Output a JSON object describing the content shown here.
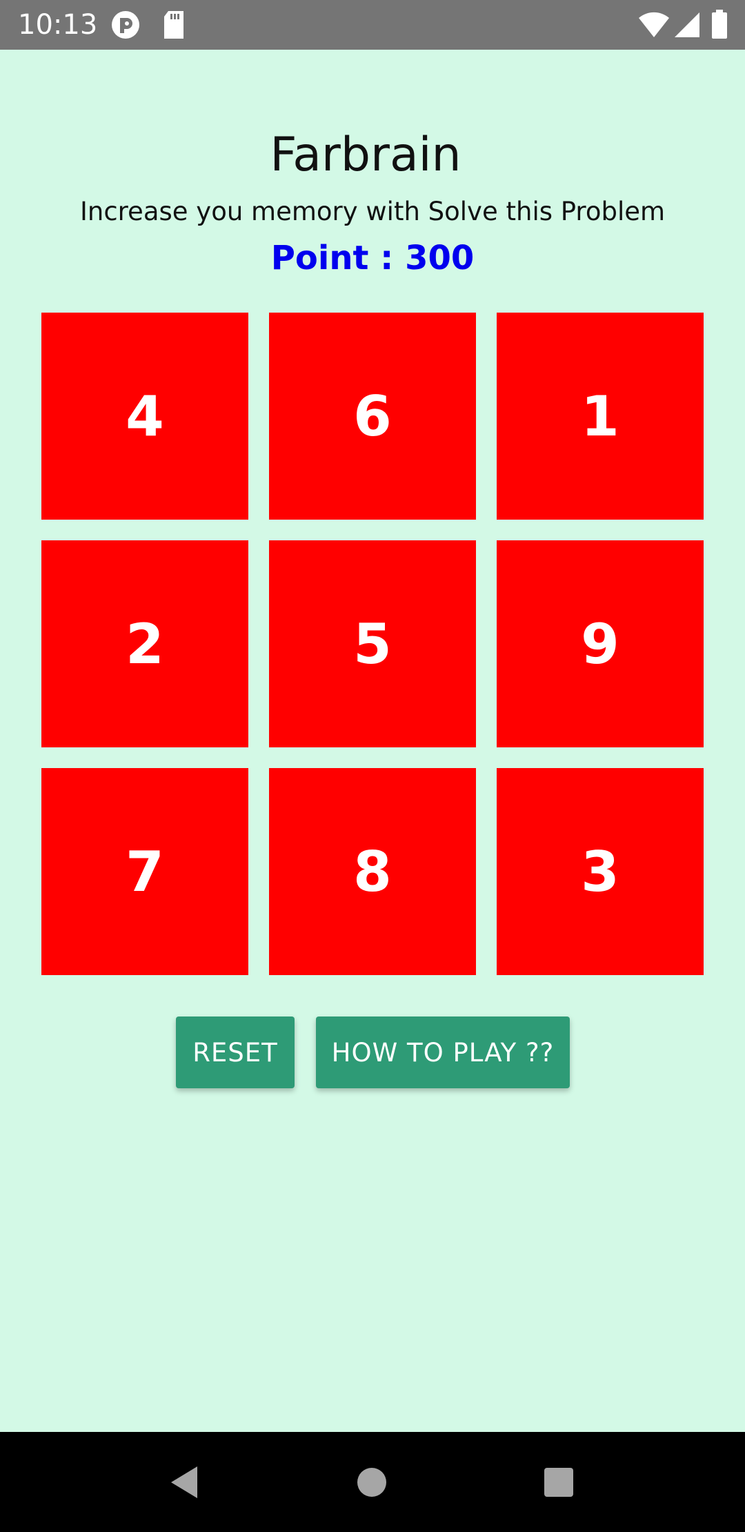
{
  "status_bar": {
    "time": "10:13",
    "icons": [
      "app-notification-icon",
      "sd-card-icon",
      "wifi-icon",
      "cell-signal-icon",
      "battery-icon"
    ]
  },
  "header": {
    "title": "Farbrain",
    "subtitle": "Increase you memory with Solve this Problem",
    "points": "Point : 300"
  },
  "grid": {
    "tiles": [
      "4",
      "6",
      "1",
      "2",
      "5",
      "9",
      "7",
      "8",
      "3"
    ]
  },
  "buttons": {
    "reset_label": "RESET",
    "how_to_play_label": "HOW TO PLAY ??"
  },
  "colors": {
    "background": "#d3f9e6",
    "tile": "#ff0000",
    "points_text": "#0000ee",
    "button": "#2e9b76",
    "status_bar": "#757575",
    "nav_bar": "#000000"
  },
  "nav_bar": {
    "icons": [
      "back-icon",
      "home-icon",
      "recents-icon"
    ]
  }
}
